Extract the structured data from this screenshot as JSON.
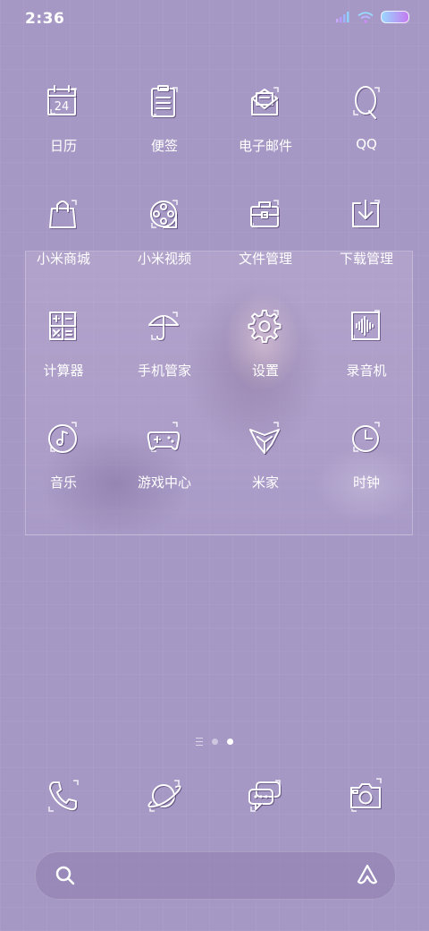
{
  "status": {
    "time": "2:36"
  },
  "apps": [
    {
      "label": "日历",
      "icon": "calendar-icon",
      "day": "24"
    },
    {
      "label": "便签",
      "icon": "notes-icon"
    },
    {
      "label": "电子邮件",
      "icon": "email-icon"
    },
    {
      "label": "QQ",
      "icon": "qq-icon"
    },
    {
      "label": "小米商城",
      "icon": "shopping-bag-icon"
    },
    {
      "label": "小米视频",
      "icon": "film-reel-icon"
    },
    {
      "label": "文件管理",
      "icon": "briefcase-icon"
    },
    {
      "label": "下载管理",
      "icon": "download-icon"
    },
    {
      "label": "计算器",
      "icon": "calculator-icon"
    },
    {
      "label": "手机管家",
      "icon": "umbrella-icon"
    },
    {
      "label": "设置",
      "icon": "gear-icon"
    },
    {
      "label": "录音机",
      "icon": "waveform-icon"
    },
    {
      "label": "音乐",
      "icon": "music-disc-icon"
    },
    {
      "label": "游戏中心",
      "icon": "gamepad-icon"
    },
    {
      "label": "米家",
      "icon": "mijia-icon"
    },
    {
      "label": "时钟",
      "icon": "clock-icon"
    }
  ],
  "dock": [
    {
      "icon": "phone-icon"
    },
    {
      "icon": "planet-browser-icon"
    },
    {
      "icon": "messages-icon"
    },
    {
      "icon": "camera-icon"
    }
  ],
  "pager": {
    "pages": 2,
    "active_page": 2
  },
  "search": {
    "icon": "search-icon",
    "assistant_icon": "ai-assistant-icon"
  },
  "colors": {
    "background": "#a698c4",
    "icon_stroke": "#ffffff"
  }
}
